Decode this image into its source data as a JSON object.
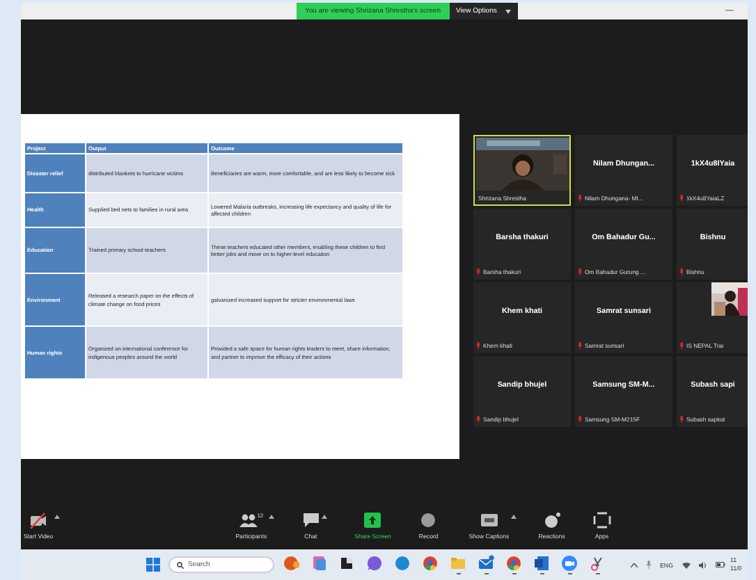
{
  "top_bar": {
    "banner": "You are viewing Shrizana Shrestha's screen",
    "view_options": "View Options",
    "minimize": "—"
  },
  "slide": {
    "table": {
      "columns": [
        "Project",
        "Output",
        "Outcome"
      ],
      "rows": [
        [
          "Disaster relief",
          "distributed blankets to hurricane victims",
          "Beneficiaries are warm, more comfortable, and are less likely to become sick"
        ],
        [
          "Health",
          "Supplied bed nets to families in rural area",
          "Lowered Malaria outbreaks, increasing life expectancy and quality of life for affected children"
        ],
        [
          "Education",
          "Trained primary school teachers",
          "These teachers educated other members, enabling these children to find better jobs and move on to higher-level education"
        ],
        [
          "Environment",
          "Released a research paper on the effects of climate change on food prices",
          "galvanized increased support for stricter environmental laws"
        ],
        [
          "Human rights",
          "Organized an international conference for indigenous peoples around the world",
          "Provided a safe space for human rights leaders to meet, share information, and partner to improve the efficacy of their actions"
        ]
      ]
    }
  },
  "participants": [
    {
      "kind": "video",
      "label": "Shrizana Shrestha",
      "muted": false,
      "speaking": true
    },
    {
      "kind": "name",
      "name": "Nilam  Dhungan...",
      "label": "Nilam Dhungana- Mt...",
      "muted": true,
      "speaking": false
    },
    {
      "kind": "name",
      "name": "1kX4u8IYaia",
      "label": "1kX4u8YaiaLZ",
      "muted": true,
      "speaking": false
    },
    {
      "kind": "name",
      "name": "Barsha thakuri",
      "label": "Barsha thakuri",
      "muted": true,
      "speaking": false
    },
    {
      "kind": "name",
      "name": "Om Bahadur Gu...",
      "label": "Om Bahadur Gurung ...",
      "muted": true,
      "speaking": false
    },
    {
      "kind": "name",
      "name": "Bishnu",
      "label": "Bishnu",
      "muted": true,
      "speaking": false
    },
    {
      "kind": "name",
      "name": "Khem khati",
      "label": "Khem khati",
      "muted": true,
      "speaking": false
    },
    {
      "kind": "name",
      "name": "Samrat sunsari",
      "label": "Samrat sunsari",
      "muted": true,
      "speaking": false
    },
    {
      "kind": "video",
      "label": "IS NEPAL Trai",
      "muted": true,
      "speaking": false
    },
    {
      "kind": "name",
      "name": "Sandip bhujel",
      "label": "Sandip bhujel",
      "muted": true,
      "speaking": false
    },
    {
      "kind": "name",
      "name": "Samsung  SM-M...",
      "label": "Samsung SM-M215F",
      "muted": true,
      "speaking": false
    },
    {
      "kind": "name",
      "name": "Subash sapi",
      "label": "Subash sapkot",
      "muted": true,
      "speaking": false
    }
  ],
  "toolbar": [
    {
      "kind": "video-off",
      "label": "Start Video",
      "caret": true
    },
    {
      "kind": "participants",
      "label": "Participants",
      "count": "12",
      "caret": true
    },
    {
      "kind": "chat",
      "label": "Chat",
      "caret": true
    },
    {
      "kind": "share",
      "label": "Share Screen",
      "caret": false
    },
    {
      "kind": "record",
      "label": "Record",
      "caret": false
    },
    {
      "kind": "captions",
      "label": "Show Captions",
      "caret": true
    },
    {
      "kind": "reactions",
      "label": "Reactions",
      "caret": false
    },
    {
      "kind": "apps",
      "label": "Apps",
      "caret": false
    }
  ],
  "taskbar": {
    "search": {
      "placeholder": "Search"
    },
    "apps": [
      {
        "kind": "copilot",
        "running": false
      },
      {
        "kind": "files",
        "running": false
      },
      {
        "kind": "taskview",
        "running": false
      },
      {
        "kind": "chat",
        "running": false
      },
      {
        "kind": "edge",
        "running": false
      },
      {
        "kind": "chrome",
        "running": false
      },
      {
        "kind": "explorer",
        "running": true
      },
      {
        "kind": "mail",
        "running": true
      },
      {
        "kind": "chrome",
        "running": true
      },
      {
        "kind": "word",
        "running": true
      },
      {
        "kind": "zoom",
        "running": true
      },
      {
        "kind": "snip",
        "running": true
      }
    ],
    "language": "ENG",
    "clock": [
      "11",
      "11/0"
    ]
  }
}
